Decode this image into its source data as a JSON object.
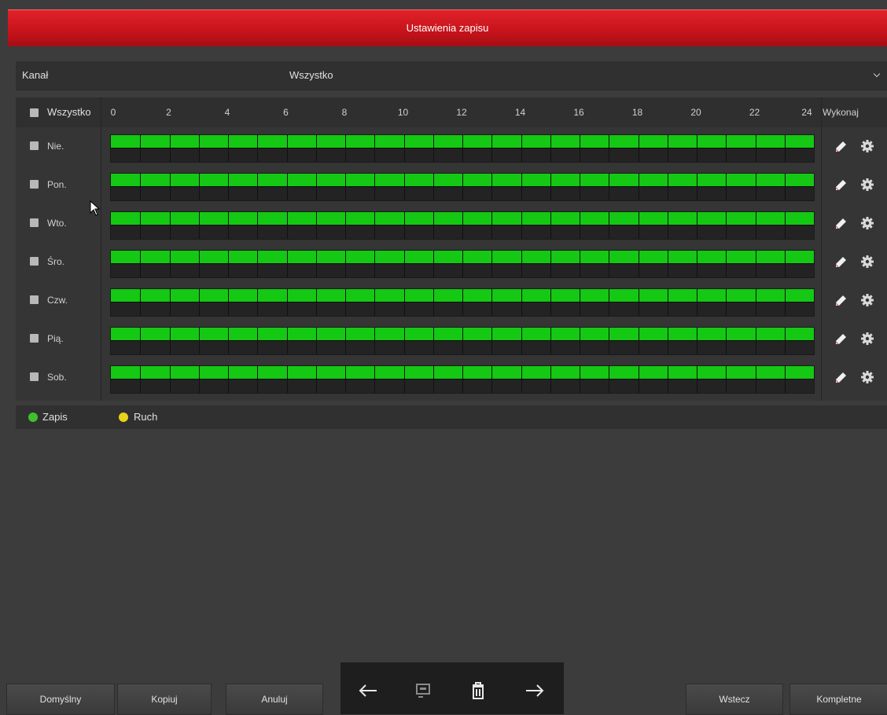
{
  "title": "Ustawienia zapisu",
  "channel": {
    "label": "Kanał",
    "value": "Wszystko"
  },
  "schedule": {
    "all_label": "Wszystko",
    "hours": [
      "0",
      "2",
      "4",
      "6",
      "8",
      "10",
      "12",
      "14",
      "16",
      "18",
      "20",
      "22",
      "24"
    ],
    "action_header": "Wykonaj",
    "days": [
      {
        "label": "Nie.",
        "recording": "Zapis",
        "coverage": [
          0,
          24
        ]
      },
      {
        "label": "Pon.",
        "recording": "Zapis",
        "coverage": [
          0,
          24
        ]
      },
      {
        "label": "Wto.",
        "recording": "Zapis",
        "coverage": [
          0,
          24
        ]
      },
      {
        "label": "Śro.",
        "recording": "Zapis",
        "coverage": [
          0,
          24
        ]
      },
      {
        "label": "Czw.",
        "recording": "Zapis",
        "coverage": [
          0,
          24
        ]
      },
      {
        "label": "Pią.",
        "recording": "Zapis",
        "coverage": [
          0,
          24
        ]
      },
      {
        "label": "Sob.",
        "recording": "Zapis",
        "coverage": [
          0,
          24
        ]
      }
    ]
  },
  "legend": [
    {
      "label": "Zapis",
      "color": "#3fbf2f"
    },
    {
      "label": "Ruch",
      "color": "#e8d21a"
    }
  ],
  "buttons": {
    "default": "Domyślny",
    "copy": "Kopiuj",
    "cancel": "Anuluj",
    "back": "Wstecz",
    "complete": "Kompletne"
  },
  "colors": {
    "title_bar": "#c8141c",
    "record_bar": "#14c814"
  },
  "icons": {
    "nav": [
      "arrow-left-icon",
      "screen-icon",
      "trash-icon",
      "arrow-right-icon"
    ],
    "row_actions": [
      "eraser-icon",
      "gear-icon"
    ]
  }
}
